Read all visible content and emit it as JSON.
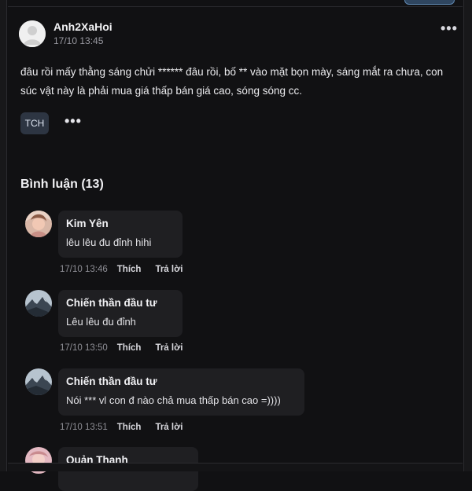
{
  "post": {
    "author": "Anh2XaHoi",
    "time": "17/10 13:45",
    "more": "•••",
    "body": "đâu rồi mấy thằng sáng chửi ****** đâu rồi, bố ** vào mặt bọn mày, sáng mắt ra chưa, con súc vật này là phải mua giá thấp bán giá cao, sóng sóng cc.",
    "tag": "TCH",
    "more_actions": "•••"
  },
  "comments_header": "Bình luận (13)",
  "comments": [
    {
      "name": "Kim Yên",
      "text": "lêu lêu đu đỉnh hihi",
      "time": "17/10 13:46",
      "like": "Thích",
      "reply": "Trả lời"
    },
    {
      "name": "Chiến thần đầu tư",
      "text": "Lêu lêu đu đỉnh",
      "time": "17/10 13:50",
      "like": "Thích",
      "reply": "Trả lời"
    },
    {
      "name": "Chiến thần đầu tư",
      "text": "Nói *** vl con đ nào chả mua thấp bán cao =))))",
      "time": "17/10 13:51",
      "like": "Thích",
      "reply": "Trả lời"
    },
    {
      "name": "Quản Thanh",
      "text": ""
    }
  ],
  "icons": {
    "post_avatar": "default-user-avatar",
    "avatar_1": "user-photo-avatar",
    "avatar_2": "mountain-photo-avatar",
    "avatar_3": "mountain-photo-avatar",
    "avatar_4": "user-photo-avatar"
  }
}
